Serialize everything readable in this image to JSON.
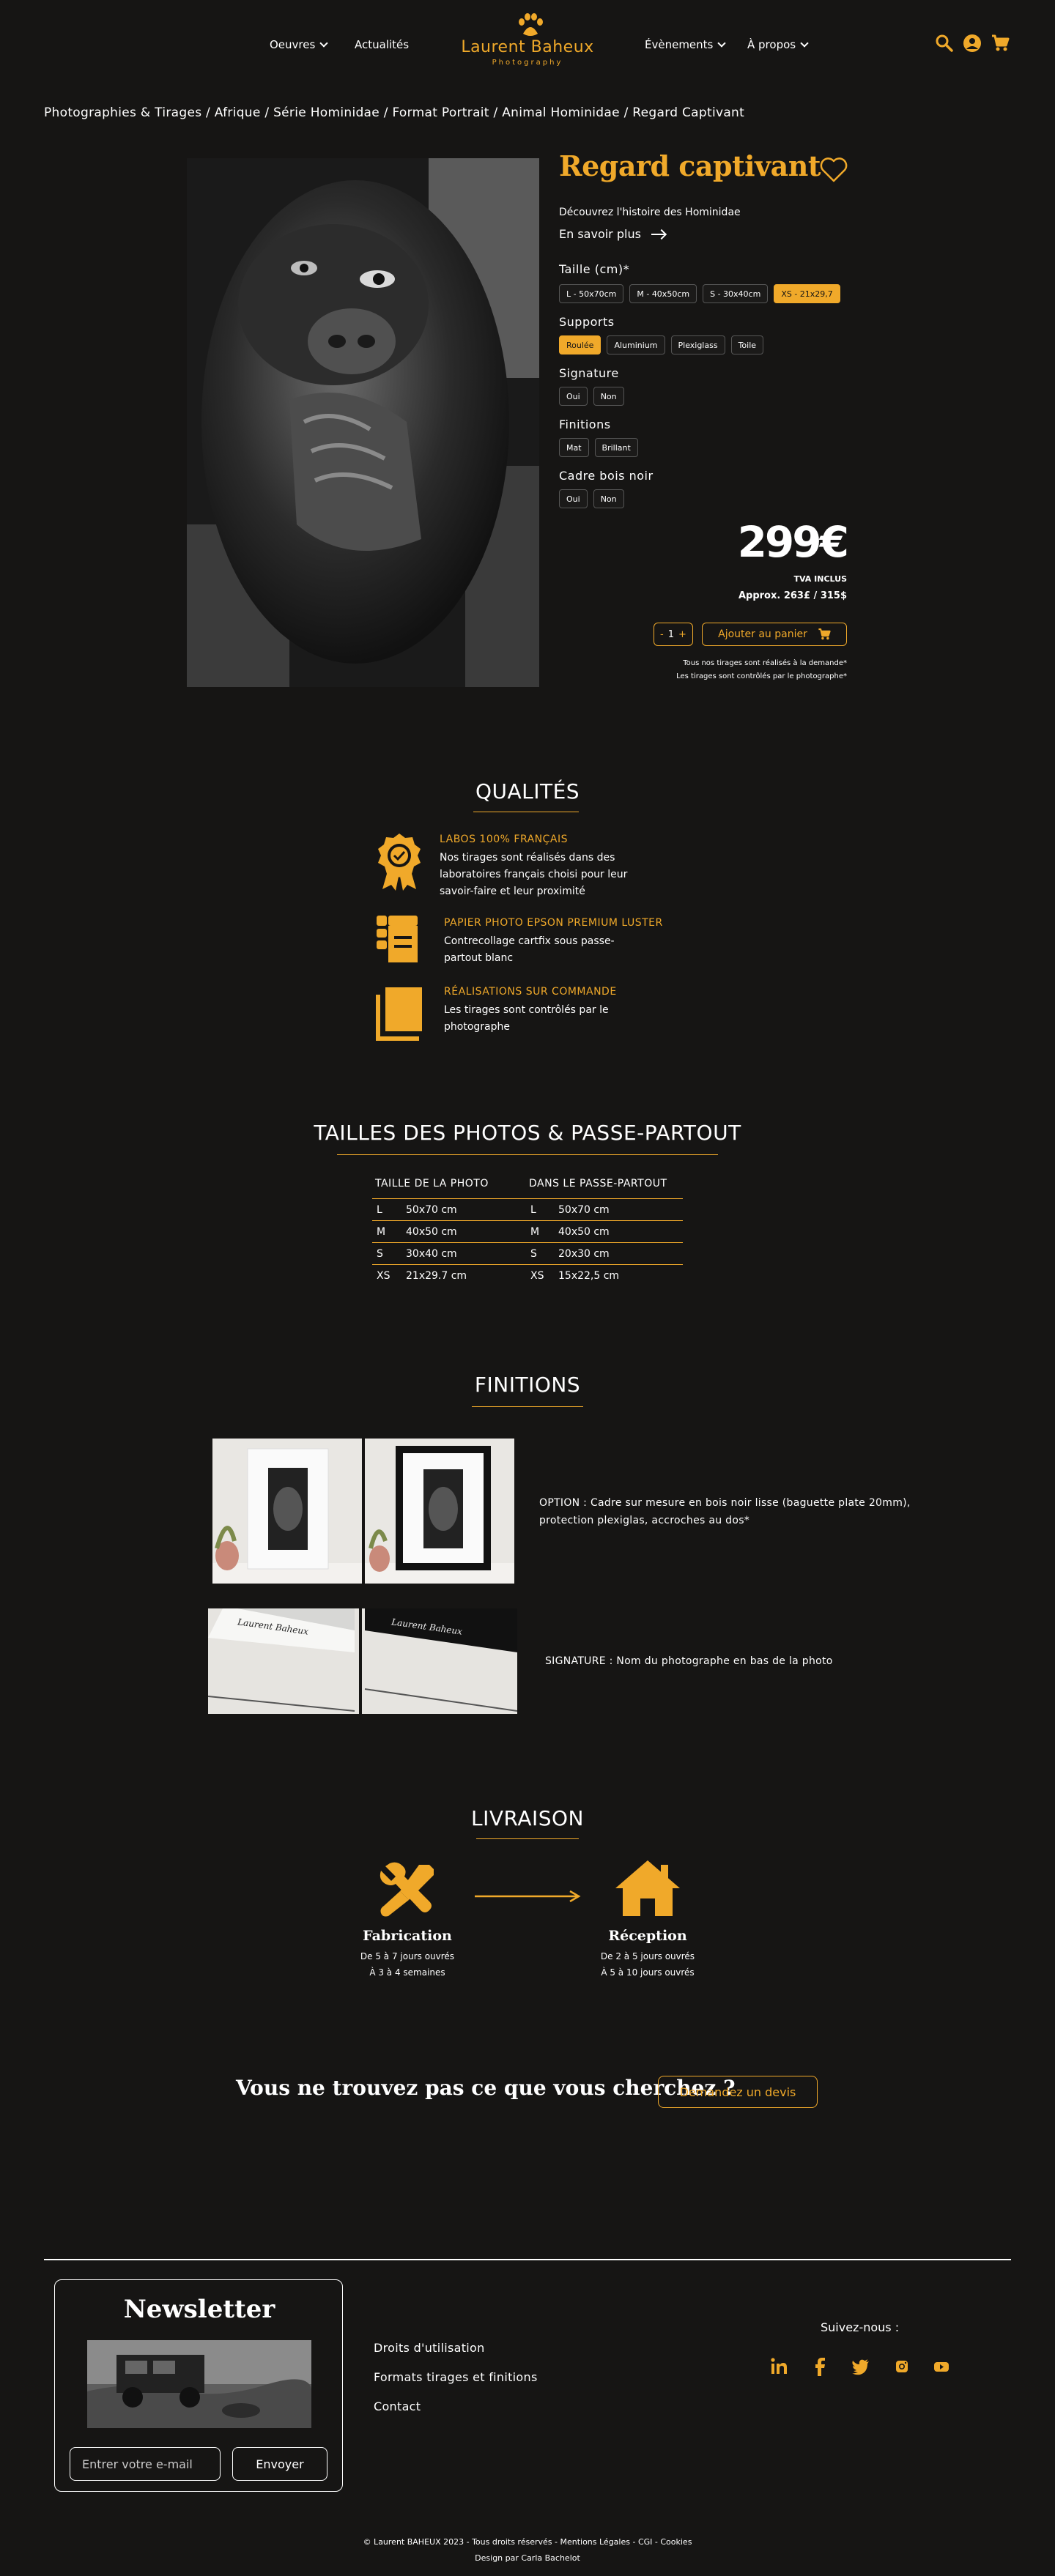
{
  "colors": {
    "accent": "#f0a92a",
    "background": "#161514",
    "text": "#ffffff"
  },
  "header": {
    "nav_left": [
      {
        "label": "Oeuvres",
        "dropdown": true
      },
      {
        "label": "Actualités",
        "dropdown": false
      }
    ],
    "logo": {
      "name": "Laurent Baheux",
      "sub": "Photography"
    },
    "nav_right": [
      {
        "label": "Évènements",
        "dropdown": true
      },
      {
        "label": "À propos",
        "dropdown": true
      }
    ],
    "icons": [
      "search-icon",
      "account-icon",
      "cart-icon"
    ]
  },
  "breadcrumb": "Photographies & Tirages / Afrique / Série Hominidae / Format Portrait / Animal Hominidae / Regard Captivant",
  "product": {
    "title": "Regard captivant",
    "discover": "Découvrez l'histoire des Hominidae",
    "more_link": "En savoir plus",
    "options": [
      {
        "label": "Taille (cm)*",
        "choices": [
          "L - 50x70cm",
          "M - 40x50cm",
          "S - 30x40cm",
          "XS - 21x29,7"
        ],
        "selected": 3
      },
      {
        "label": "Supports",
        "choices": [
          "Roulée",
          "Aluminium",
          "Plexiglass",
          "Toile"
        ],
        "selected": 0
      },
      {
        "label": "Signature",
        "choices": [
          "Oui",
          "Non"
        ],
        "selected": -1
      },
      {
        "label": "Finitions",
        "choices": [
          "Mat",
          "Brillant"
        ],
        "selected": -1
      },
      {
        "label": "Cadre bois noir",
        "choices": [
          "Oui",
          "Non"
        ],
        "selected": -1
      }
    ],
    "price": "299€",
    "tva": "TVA INCLUS",
    "approx": "Approx. 263£ / 315$",
    "qty_minus": "-",
    "qty_value": "1",
    "qty_plus": "+",
    "add_to_cart": "Ajouter au panier",
    "note_1": "Tous nos tirages sont réalisés à la demande*",
    "note_2": "Les tirages sont contrôlés par le photographe*"
  },
  "qualities": {
    "title": "QUALITÉS",
    "items": [
      {
        "icon": "award-badge-icon",
        "heading": "LABOS 100% FRANÇAIS",
        "text": "Nos tirages sont réalisés dans des laboratoires français choisi pour leur savoir-faire et leur proximité"
      },
      {
        "icon": "paper-roll-icon",
        "heading": "PAPIER PHOTO EPSON PREMIUM LUSTER",
        "text": "Contrecollage cartfix sous passe-partout blanc"
      },
      {
        "icon": "stacked-prints-icon",
        "heading": "RÉALISATIONS SUR COMMANDE",
        "text": "Les tirages sont contrôlés par le photographe"
      }
    ]
  },
  "sizes": {
    "title": "TAILLES DES PHOTOS & PASSE-PARTOUT",
    "col_photo": "TAILLE DE LA PHOTO",
    "col_mat": "DANS LE PASSE-PARTOUT",
    "rows": [
      {
        "code": "L",
        "photo": "50x70 cm",
        "code2": "L",
        "mat": "50x70 cm"
      },
      {
        "code": "M",
        "photo": "40x50 cm",
        "code2": "M",
        "mat": "40x50 cm"
      },
      {
        "code": "S",
        "photo": "30x40 cm",
        "code2": "S",
        "mat": "20x30 cm"
      },
      {
        "code": "XS",
        "photo": "21x29.7 cm",
        "code2": "XS",
        "mat": "15x22,5 cm"
      }
    ]
  },
  "finishes": {
    "title": "FINITIONS",
    "frame_text": "OPTION : Cadre sur mesure en bois noir lisse (baguette plate 20mm), protection plexiglas, accroches au dos*",
    "signature_text": "SIGNATURE : Nom du photographe en bas de la photo",
    "signature_script": "Laurent Baheux"
  },
  "delivery": {
    "title": "LIVRAISON",
    "steps": [
      {
        "icon": "tools-icon",
        "title": "Fabrication",
        "line1": "De 5 à 7 jours ouvrés",
        "line2": "À 3 à 4 semaines"
      },
      {
        "icon": "house-icon",
        "title": "Réception",
        "line1": "De 2 à 5 jours ouvrés",
        "line2": "À 5 à 10 jours ouvrés"
      }
    ]
  },
  "cta": {
    "question": "Vous ne trouvez pas ce que vous cherchez ?",
    "button": "Demandez un devis"
  },
  "footer": {
    "newsletter_title": "Newsletter",
    "email_placeholder": "Entrer votre e-mail",
    "send": "Envoyer",
    "links": [
      "Droits d'utilisation",
      "Formats tirages et finitions",
      "Contact"
    ],
    "follow": "Suivez-nous :",
    "social": [
      "linkedin-icon",
      "facebook-icon",
      "twitter-icon",
      "instagram-icon",
      "youtube-icon"
    ],
    "copyright": "© Laurent BAHEUX 2023 - Tous droits réservés - Mentions Légales - CGI - Cookies",
    "design": "Design par Carla Bachelot"
  }
}
